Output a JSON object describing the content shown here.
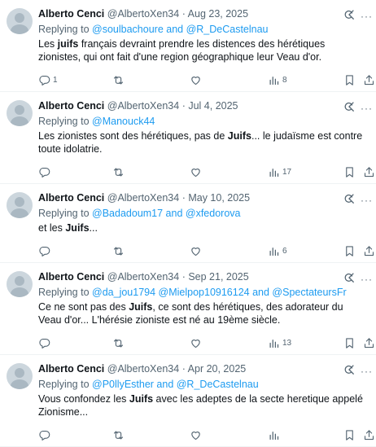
{
  "tweets": [
    {
      "name": "Alberto Cenci",
      "handle": "@AlbertoXen34",
      "separator": "·",
      "date": "Aug 23, 2025",
      "replying_prefix": "Replying to",
      "replying_to": "@soulbachoure and @R_DeCastelnau",
      "text_parts": [
        {
          "t": "Les ",
          "b": false
        },
        {
          "t": "juifs",
          "b": true
        },
        {
          "t": " français devraint prendre les distences des hérétiques zionistes, qui ont fait d'une region géographique leur Veau d'or.",
          "b": false
        }
      ],
      "replies": "1",
      "retweets": "",
      "likes": "",
      "views": "8"
    },
    {
      "name": "Alberto Cenci",
      "handle": "@AlbertoXen34",
      "separator": "·",
      "date": "Jul 4, 2025",
      "replying_prefix": "Replying to",
      "replying_to": "@Manouck44",
      "text_parts": [
        {
          "t": "Les zionistes sont des hérétiques, pas de ",
          "b": false
        },
        {
          "t": "Juifs",
          "b": true
        },
        {
          "t": "... le judaïsme est contre toute idolatrie.",
          "b": false
        }
      ],
      "replies": "",
      "retweets": "",
      "likes": "",
      "views": "17"
    },
    {
      "name": "Alberto Cenci",
      "handle": "@AlbertoXen34",
      "separator": "·",
      "date": "May 10, 2025",
      "replying_prefix": "Replying to",
      "replying_to": "@Badadoum17 and @xfedorova",
      "text_parts": [
        {
          "t": "et les ",
          "b": false
        },
        {
          "t": "Juifs",
          "b": true
        },
        {
          "t": "...",
          "b": false
        }
      ],
      "replies": "",
      "retweets": "",
      "likes": "",
      "views": "6"
    },
    {
      "name": "Alberto Cenci",
      "handle": "@AlbertoXen34",
      "separator": "·",
      "date": "Sep 21, 2025",
      "replying_prefix": "Replying to",
      "replying_to": "@da_jou1794 @Mielpop10916124 and @SpectateursFr",
      "text_parts": [
        {
          "t": "Ce ne sont pas des ",
          "b": false
        },
        {
          "t": "Juifs",
          "b": true
        },
        {
          "t": ", ce sont des hérétiques, des adorateur du Veau d'or... L'hérésie zioniste est né au 19ème siècle.",
          "b": false
        }
      ],
      "replies": "",
      "retweets": "",
      "likes": "",
      "views": "13"
    },
    {
      "name": "Alberto Cenci",
      "handle": "@AlbertoXen34",
      "separator": "·",
      "date": "Apr 20, 2025",
      "replying_prefix": "Replying to",
      "replying_to": "@P0llyEsther and @R_DeCastelnau",
      "text_parts": [
        {
          "t": "Vous confondez les ",
          "b": false
        },
        {
          "t": "Juifs",
          "b": true
        },
        {
          "t": " avec les adeptes de la secte heretique appelé Zionisme...",
          "b": false
        }
      ],
      "replies": "",
      "retweets": "",
      "likes": "",
      "views": ""
    }
  ],
  "icons": {
    "reply": "reply-icon",
    "retweet": "retweet-icon",
    "like": "heart-icon",
    "views": "views-icon",
    "bookmark": "bookmark-icon",
    "share": "share-icon",
    "grok": "grok-icon",
    "more": "more-icon"
  },
  "colors": {
    "link": "#1d9bf0",
    "muted": "#536471",
    "text": "#0f1419",
    "divider": "#eff3f4"
  }
}
